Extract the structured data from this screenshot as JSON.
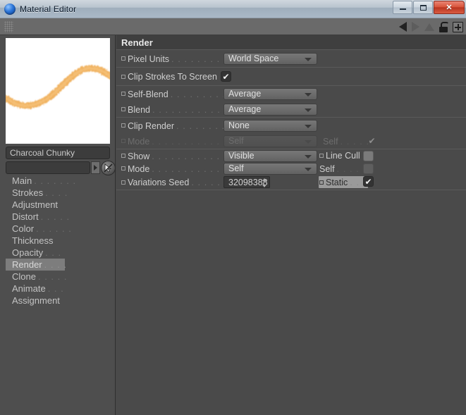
{
  "window": {
    "title": "Material Editor",
    "app_icon": "sphere-icon",
    "buttons": {
      "minimize": "minimize-icon",
      "maximize": "maximize-icon",
      "close": "✕"
    }
  },
  "toolbar": {
    "grip": "drag-grip",
    "back": "arrow-left-icon",
    "forward": "arrow-right-icon",
    "up": "arrow-up-icon",
    "lock": "lock-icon",
    "add": "plus-icon"
  },
  "sidebar": {
    "preview_alt": "brush-stroke-preview",
    "stroke_color": "#efac52",
    "material_name": "Charcoal Chunky",
    "search_value": "",
    "search_dropdown": "chevron-down-icon",
    "picker": "cursor-picker-icon",
    "items": [
      {
        "label": "Main",
        "dots": ". . . . . . .",
        "active": false
      },
      {
        "label": "Strokes",
        "dots": ". . . .",
        "active": false
      },
      {
        "label": "Adjustment",
        "dots": "",
        "active": false
      },
      {
        "label": "Distort",
        "dots": ". . . . .",
        "active": false
      },
      {
        "label": "Color",
        "dots": ". . . . . .",
        "active": false
      },
      {
        "label": "Thickness",
        "dots": "",
        "active": false
      },
      {
        "label": "Opacity",
        "dots": ". . .",
        "active": false
      },
      {
        "label": "Render",
        "dots": ". . . .",
        "active": true
      },
      {
        "label": "Clone",
        "dots": ". . . . .",
        "active": false
      },
      {
        "label": "Animate",
        "dots": ". . .",
        "active": false
      },
      {
        "label": "Assignment",
        "dots": "",
        "active": false
      }
    ]
  },
  "main": {
    "section_title": "Render",
    "rows": {
      "pixel_units": {
        "label": "Pixel Units",
        "dots": ". . . . . . . . . . .",
        "value": "World Space"
      },
      "clip_strokes": {
        "label": "Clip Strokes To Screen",
        "checked": "✔"
      },
      "self_blend": {
        "label": "Self-Blend",
        "dots": ". . . . . . . . .",
        "value": "Average"
      },
      "blend": {
        "label": "Blend",
        "dots": ". . . . . . . . . . . .",
        "value": "Average"
      },
      "clip_render": {
        "label": "Clip Render",
        "dots": ". . . . . . . . .",
        "value": "None"
      },
      "clip_mode": {
        "label": "Mode",
        "dots": ". . . . . . . . . . . . .",
        "value": "Self"
      },
      "clip_self": {
        "label": "Self",
        "dots": ". . . . .",
        "checked": "✔"
      },
      "show": {
        "label": "Show",
        "dots": ". . . . . . . . . . . . .",
        "value": "Visible"
      },
      "line_cull": {
        "label": "Line Cull",
        "checked": ""
      },
      "mode": {
        "label": "Mode",
        "dots": ". . . . . . . . . . . . .",
        "value": "Self"
      },
      "mode_self": {
        "label": "Self",
        "dots": ". . . . .",
        "checked": ""
      },
      "variations_seed": {
        "label": "Variations Seed",
        "dots": ". . . . . . .",
        "value": "32098388"
      },
      "static": {
        "label": "Static",
        "dots": ". . .",
        "checked": "✔"
      }
    }
  }
}
